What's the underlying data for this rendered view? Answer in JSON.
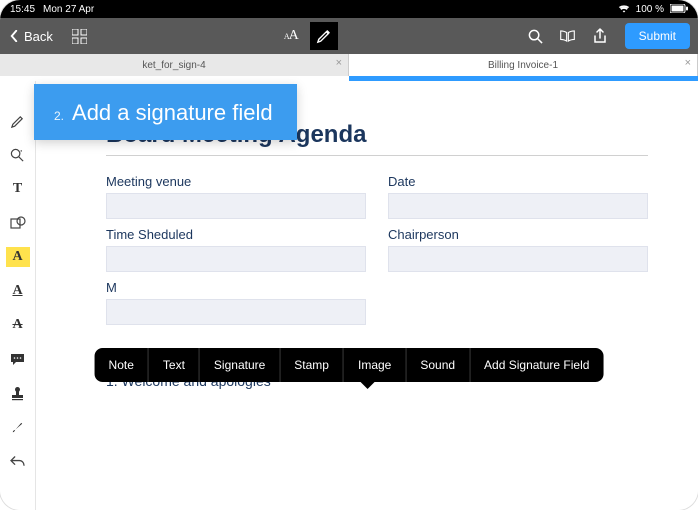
{
  "statusbar": {
    "time": "15:45",
    "date": "Mon 27 Apr",
    "battery": "100 %"
  },
  "topbar": {
    "back_label": "Back",
    "submit_label": "Submit"
  },
  "tabs": [
    {
      "label": "ket_for_sign-4"
    },
    {
      "label": "Billing Invoice-1"
    }
  ],
  "callout": {
    "number": "2.",
    "text": "Add a signature field"
  },
  "document": {
    "title": "Board Meeting Agenda",
    "fields": {
      "meeting_venue": "Meeting venue",
      "date": "Date",
      "time_scheduled": "Time Sheduled",
      "chairperson": "Chairperson",
      "minutes_by": "M"
    },
    "agenda_first": "1.   Welcome and apologies"
  },
  "popup": {
    "note": "Note",
    "text": "Text",
    "signature": "Signature",
    "stamp": "Stamp",
    "image": "Image",
    "sound": "Sound",
    "add_sig_field": "Add Signature Field"
  },
  "sidebar_tools": {
    "draw": "draw-tool",
    "search": "inspect-tool",
    "text": "text-tool",
    "shape": "shape-tool",
    "highlight": "highlight-tool",
    "underline": "underline-tool",
    "strike": "strike-tool",
    "comment": "comment-tool",
    "stamp": "stamp-tool",
    "brush": "brush-tool",
    "undo": "undo-tool"
  }
}
